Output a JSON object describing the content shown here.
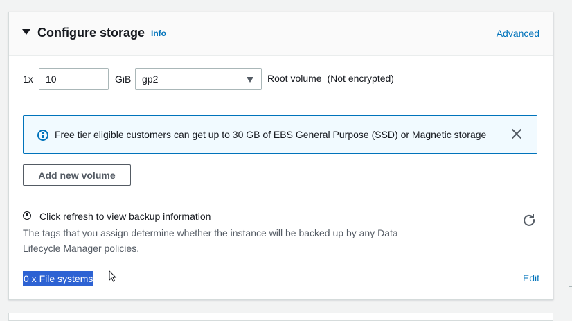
{
  "header": {
    "title": "Configure storage",
    "info_link": "Info",
    "advanced_link": "Advanced"
  },
  "volume": {
    "count_label": "1x",
    "size_value": "10",
    "size_unit": "GiB",
    "type_selected": "gp2",
    "root_label": "Root volume",
    "encryption_label": "(Not encrypted)"
  },
  "alert": {
    "message": "Free tier eligible customers can get up to 30 GB of EBS General Purpose (SSD) or Magnetic storage"
  },
  "buttons": {
    "add_volume": "Add new volume"
  },
  "backup": {
    "title": "Click refresh to view backup information",
    "description": "The tags that you assign determine whether the instance will be backed up by any Data Lifecycle Manager policies."
  },
  "file_systems": {
    "label": "0 x File systems",
    "edit_link": "Edit"
  },
  "colors": {
    "link": "#0073bb",
    "alert_background": "#f1faff",
    "selection_highlight": "#2d62d3"
  }
}
